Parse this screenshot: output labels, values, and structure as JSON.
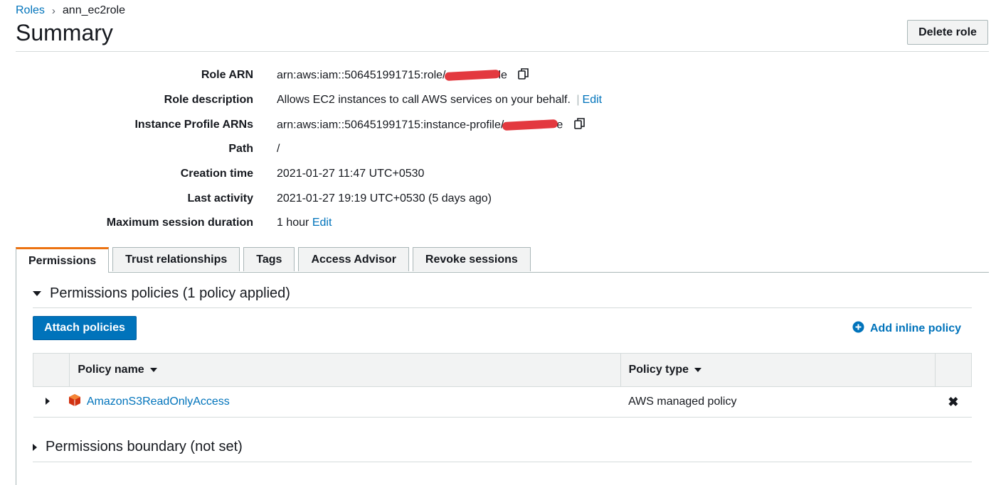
{
  "breadcrumb": {
    "parent": "Roles",
    "current": "ann_ec2role"
  },
  "page": {
    "title": "Summary",
    "delete_label": "Delete role"
  },
  "details": [
    {
      "label": "Role ARN",
      "value_prefix": "arn:aws:iam::506451991715:role/",
      "value_suffix": "le",
      "edit": ""
    },
    {
      "label": "Role description",
      "value": "Allows EC2 instances to call AWS services on your behalf.",
      "edit": "Edit"
    },
    {
      "label": "Instance Profile ARNs",
      "value_prefix": "arn:aws:iam::506451991715:instance-profile/",
      "value_suffix": "e"
    },
    {
      "label": "Path",
      "value": "/"
    },
    {
      "label": "Creation time",
      "value": "2021-01-27 11:47 UTC+0530"
    },
    {
      "label": "Last activity",
      "value": "2021-01-27 19:19 UTC+0530 (5 days ago)"
    },
    {
      "label": "Maximum session duration",
      "value": "1 hour",
      "edit": "Edit"
    }
  ],
  "tabs": [
    "Permissions",
    "Trust relationships",
    "Tags",
    "Access Advisor",
    "Revoke sessions"
  ],
  "permissions": {
    "policies_heading": "Permissions policies (1 policy applied)",
    "attach_label": "Attach policies",
    "add_inline_label": "Add inline policy",
    "columns": [
      "Policy name",
      "Policy type"
    ],
    "rows": [
      {
        "name": "AmazonS3ReadOnlyAccess",
        "type": "AWS managed policy"
      }
    ],
    "boundary_heading": "Permissions boundary (not set)"
  },
  "colors": {
    "accent": "#0073bb",
    "tab_active": "#ec7211",
    "s3_icon": "#e7157b"
  }
}
